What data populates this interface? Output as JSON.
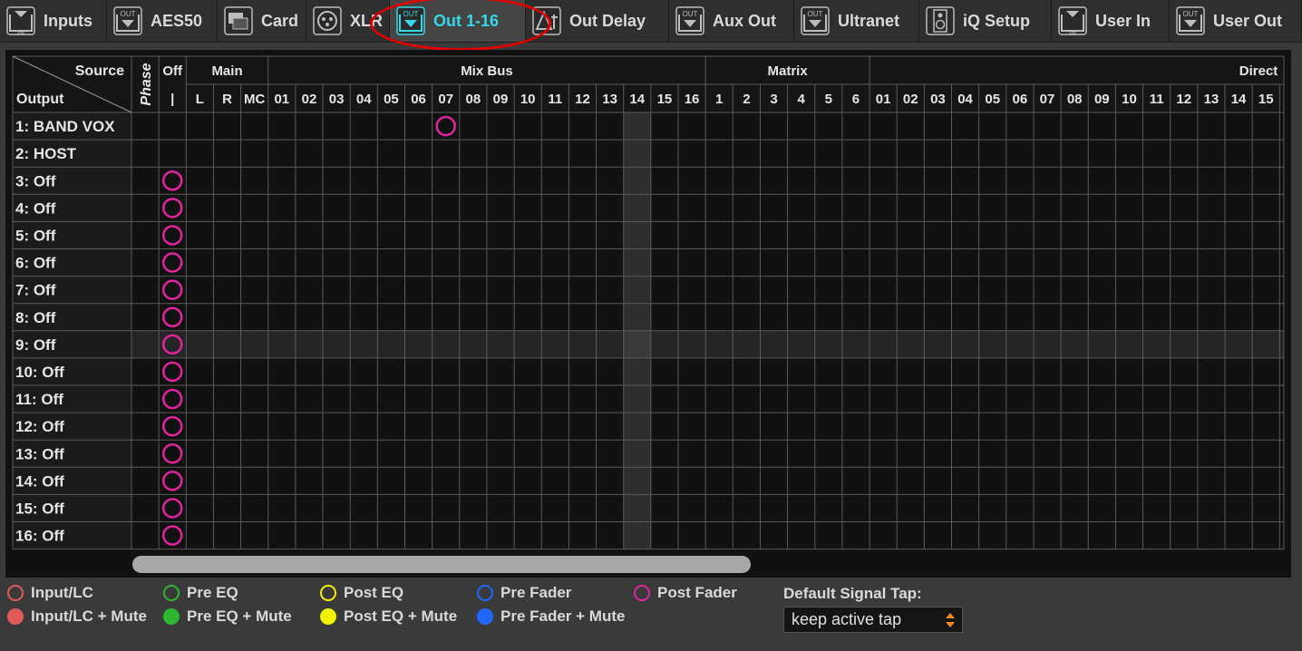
{
  "toolbar": {
    "tabs": [
      {
        "label": "Inputs",
        "icon": "port-in-icon",
        "icon_text": "IN"
      },
      {
        "label": "AES50",
        "icon": "port-out-icon",
        "icon_text": "OUT"
      },
      {
        "label": "Card",
        "icon": "card-icon",
        "icon_text": ""
      },
      {
        "label": "XLR",
        "icon": "xlr-icon",
        "icon_text": ""
      },
      {
        "label": "Out 1-16",
        "icon": "port-out-icon",
        "icon_text": "OUT",
        "active": true
      },
      {
        "label": "Out Delay",
        "icon": "delay-icon",
        "icon_text": ""
      },
      {
        "label": "Aux Out",
        "icon": "port-out-icon",
        "icon_text": "OUT"
      },
      {
        "label": "Ultranet",
        "icon": "port-out-icon",
        "icon_text": "OUT"
      },
      {
        "label": "iQ Setup",
        "icon": "speaker-icon",
        "icon_text": ""
      },
      {
        "label": "User In",
        "icon": "port-in-icon",
        "icon_text": "IN"
      },
      {
        "label": "User Out",
        "icon": "port-out-icon",
        "icon_text": "OUT"
      }
    ]
  },
  "grid": {
    "corner_source": "Source",
    "corner_output": "Output",
    "phase_label": "Phase",
    "off_label": "Off",
    "off_sub": "|",
    "groups": {
      "main": "Main",
      "mixbus": "Mix Bus",
      "matrix": "Matrix",
      "direct": "Direct"
    },
    "main_cols": [
      "L",
      "R",
      "MC"
    ],
    "mixbus_cols": [
      "01",
      "02",
      "03",
      "04",
      "05",
      "06",
      "07",
      "08",
      "09",
      "10",
      "11",
      "12",
      "13",
      "14",
      "15",
      "16"
    ],
    "matrix_cols": [
      "1",
      "2",
      "3",
      "4",
      "5",
      "6"
    ],
    "direct_cols": [
      "01",
      "02",
      "03",
      "04",
      "05",
      "06",
      "07",
      "08",
      "09",
      "10",
      "11",
      "12",
      "13",
      "14",
      "15"
    ],
    "highlight_column": "Mix Bus 14",
    "highlight_row": "9: Off",
    "rows": [
      {
        "label": "1: BAND VOX",
        "route": "Mix Bus 07",
        "tap": "Post Fader"
      },
      {
        "label": "2: HOST",
        "route": "",
        "tap": ""
      },
      {
        "label": "3: Off",
        "route": "Off",
        "tap": "Post Fader"
      },
      {
        "label": "4: Off",
        "route": "Off",
        "tap": "Post Fader"
      },
      {
        "label": "5: Off",
        "route": "Off",
        "tap": "Post Fader"
      },
      {
        "label": "6: Off",
        "route": "Off",
        "tap": "Post Fader"
      },
      {
        "label": "7: Off",
        "route": "Off",
        "tap": "Post Fader"
      },
      {
        "label": "8: Off",
        "route": "Off",
        "tap": "Post Fader"
      },
      {
        "label": "9: Off",
        "route": "Off",
        "tap": "Post Fader"
      },
      {
        "label": "10: Off",
        "route": "Off",
        "tap": "Post Fader"
      },
      {
        "label": "11: Off",
        "route": "Off",
        "tap": "Post Fader"
      },
      {
        "label": "12: Off",
        "route": "Off",
        "tap": "Post Fader"
      },
      {
        "label": "13: Off",
        "route": "Off",
        "tap": "Post Fader"
      },
      {
        "label": "14: Off",
        "route": "Off",
        "tap": "Post Fader"
      },
      {
        "label": "15: Off",
        "route": "Off",
        "tap": "Post Fader"
      },
      {
        "label": "16: Off",
        "route": "Off",
        "tap": "Post Fader"
      }
    ]
  },
  "legend": {
    "items": [
      {
        "label": "Input/LC",
        "color": "#e05a5a",
        "filled": false
      },
      {
        "label": "Pre EQ",
        "color": "#2fb52f",
        "filled": false
      },
      {
        "label": "Post EQ",
        "color": "#f2f200",
        "filled": false
      },
      {
        "label": "Pre Fader",
        "color": "#1f66ff",
        "filled": false
      },
      {
        "label": "Post Fader",
        "color": "#e0259f",
        "filled": false
      },
      {
        "label": "Input/LC + Mute",
        "color": "#e05a5a",
        "filled": true
      },
      {
        "label": "Pre EQ + Mute",
        "color": "#2fb52f",
        "filled": true
      },
      {
        "label": "Post EQ + Mute",
        "color": "#f2f200",
        "filled": true
      },
      {
        "label": "Pre Fader + Mute",
        "color": "#1f66ff",
        "filled": true
      }
    ]
  },
  "default_tap": {
    "label": "Default Signal Tap:",
    "value": "keep active tap",
    "arrow_color": "#f08a1a"
  },
  "colors": {
    "active_tab_text": "#36d6e6",
    "highlight_ellipse": "#e00000"
  }
}
